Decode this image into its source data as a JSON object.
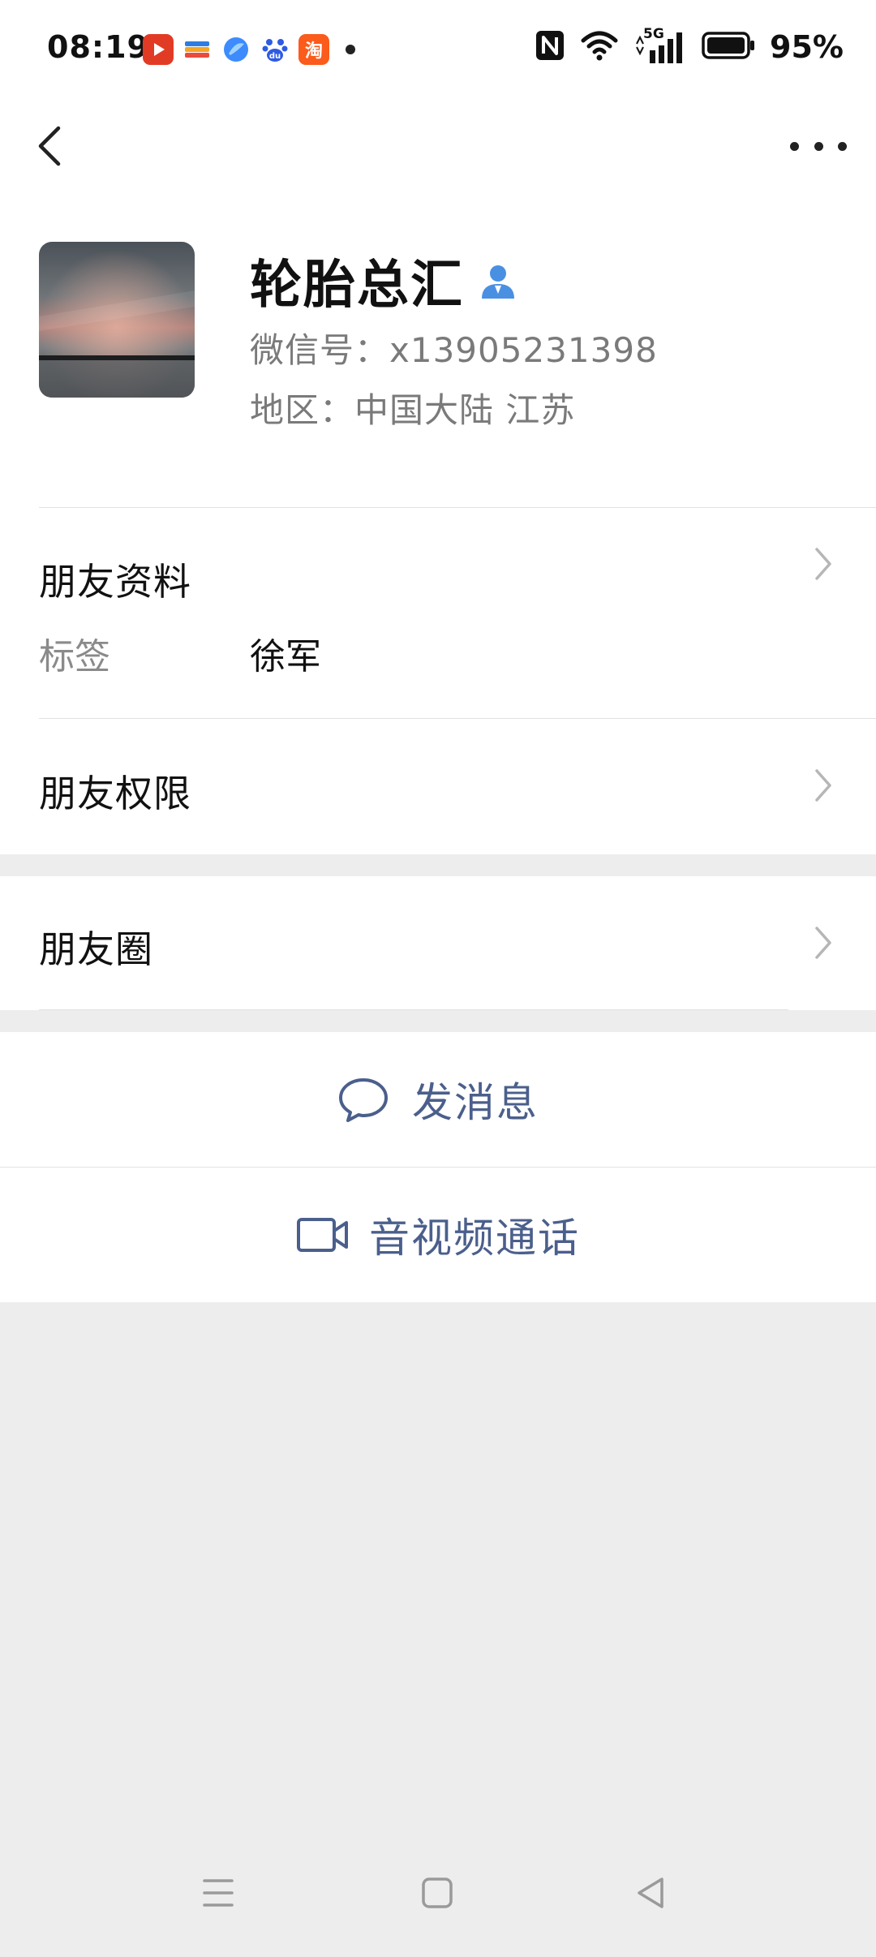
{
  "status_bar": {
    "time": "08:19",
    "battery": "95%",
    "notification_icons": [
      "video-app-icon",
      "wallet-icon",
      "browser-icon",
      "baidu-icon",
      "taobao-icon"
    ],
    "taobao_glyph": "淘",
    "signal_label": "5G"
  },
  "profile": {
    "name": "轮胎总汇",
    "wechat_id": "微信号：x13905231398",
    "region": "地区：中国大陆  江苏"
  },
  "friend_info": {
    "title": "朋友资料",
    "tag_label": "标签",
    "tag_value": "徐军"
  },
  "permissions": {
    "title": "朋友权限"
  },
  "moments": {
    "title": "朋友圈"
  },
  "actions": {
    "message": "发消息",
    "call": "音视频通话"
  },
  "colors": {
    "accent_text": "#4b5f8c",
    "background": "#ededed",
    "contact_icon": "#4a90e2"
  }
}
